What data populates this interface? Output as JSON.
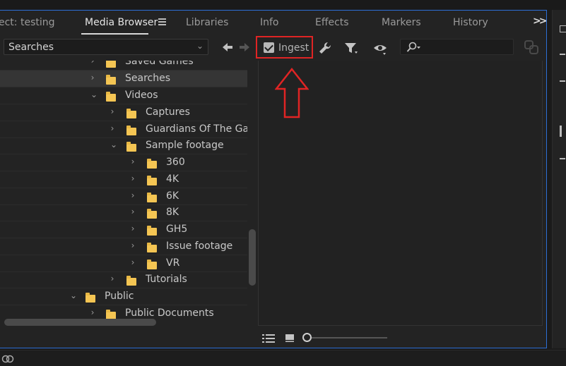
{
  "tabs": [
    {
      "label": "ect: testing",
      "active": false
    },
    {
      "label": "Media Browser",
      "active": true
    },
    {
      "label": "Libraries",
      "active": false
    },
    {
      "label": "Info",
      "active": false
    },
    {
      "label": "Effects",
      "active": false
    },
    {
      "label": "Markers",
      "active": false
    },
    {
      "label": "History",
      "active": false
    }
  ],
  "icons": {
    "panel_menu": "hamburger-menu-icon",
    "overflow": "double-chevron-right-icon",
    "back": "arrow-left-icon",
    "forward": "arrow-right-icon",
    "settings": "wrench-icon",
    "filter": "filter-funnel-icon",
    "view": "eye-icon",
    "search": "magnifier-icon",
    "link": "link-icon",
    "list_view": "list-view-icon",
    "icon_view": "thumbnail-view-icon",
    "annotation": "red-up-arrow-icon",
    "creative_cloud": "creative-cloud-icon"
  },
  "toolbar": {
    "location_value": "Searches",
    "ingest_label": "Ingest",
    "ingest_checked": true,
    "search_placeholder": ""
  },
  "tree": [
    {
      "label": "Saved Games",
      "expanded": false
    },
    {
      "label": "Searches",
      "expanded": false,
      "selected": true
    },
    {
      "label": "Videos",
      "expanded": true
    },
    {
      "label": "Captures",
      "expanded": false
    },
    {
      "label": "Guardians Of The Galax",
      "expanded": false
    },
    {
      "label": "Sample footage",
      "expanded": true
    },
    {
      "label": "360",
      "expanded": false
    },
    {
      "label": "4K",
      "expanded": false
    },
    {
      "label": "6K",
      "expanded": false
    },
    {
      "label": "8K",
      "expanded": false
    },
    {
      "label": "GH5",
      "expanded": false
    },
    {
      "label": "Issue footage",
      "expanded": false
    },
    {
      "label": "VR",
      "expanded": false
    },
    {
      "label": "Tutorials",
      "expanded": false
    },
    {
      "label": "Public",
      "expanded": true
    },
    {
      "label": "Public Documents",
      "expanded": false
    }
  ],
  "colors": {
    "accent_border": "#2d6fd6",
    "highlight_red": "#e02424",
    "folder": "#f4c553"
  }
}
